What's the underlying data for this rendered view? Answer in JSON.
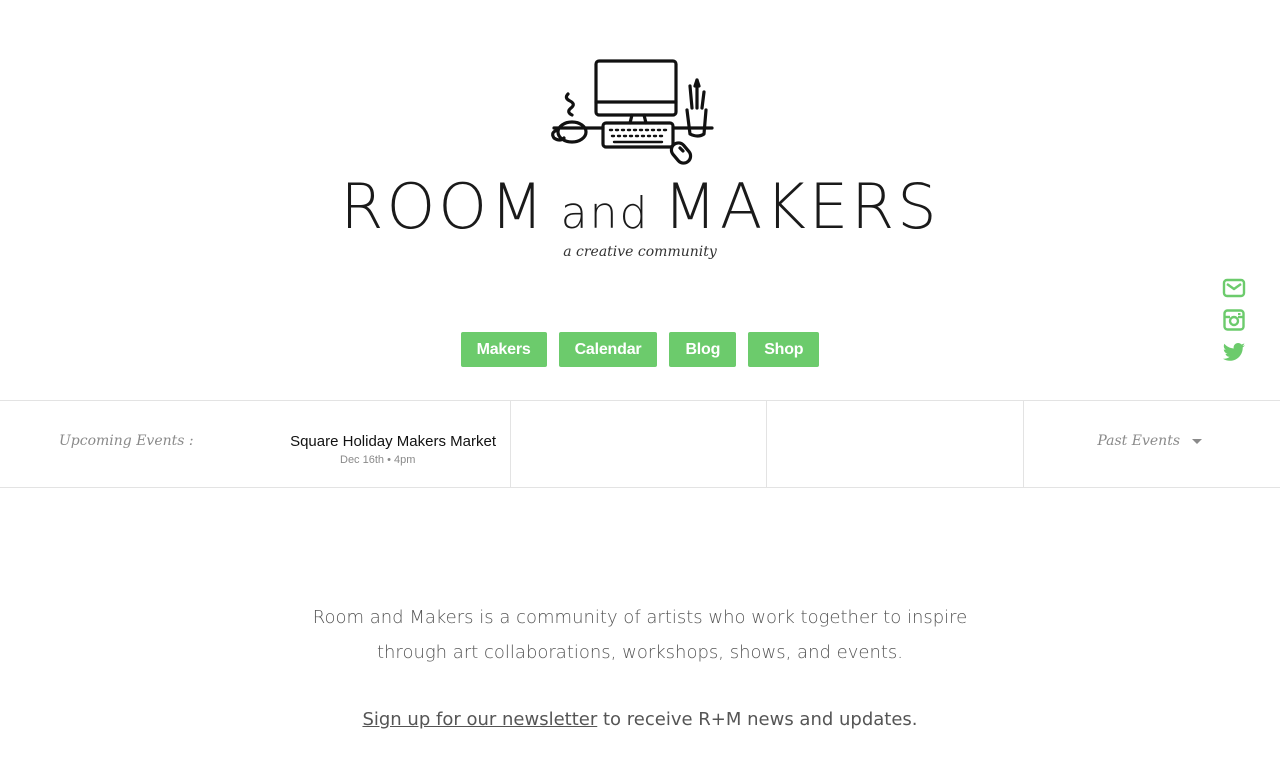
{
  "header": {
    "brand_left": "ROOM",
    "brand_and": "and",
    "brand_right": "MAKERS",
    "tagline": "a creative community",
    "logo_icon": "desk-computer-illustration"
  },
  "social": {
    "email_icon": "envelope-icon",
    "instagram_icon": "instagram-icon",
    "twitter_icon": "twitter-icon",
    "accent": "#6ccb6c"
  },
  "nav": {
    "items": [
      {
        "label": "Makers"
      },
      {
        "label": "Calendar"
      },
      {
        "label": "Blog"
      },
      {
        "label": "Shop"
      }
    ],
    "bg": "#6ccb6c"
  },
  "events": {
    "upcoming_label": "Upcoming Events :",
    "items": [
      {
        "title": "Square Holiday Makers Market",
        "date": "Dec 16th • 4pm"
      }
    ],
    "past_label": "Past Events"
  },
  "intro": {
    "line1": "Room and Makers is a community of artists who work together to inspire",
    "line2": "through art collaborations, workshops, shows, and events.",
    "newsletter_link": "Sign up for our newsletter",
    "newsletter_rest": " to receive R+M news and updates."
  }
}
